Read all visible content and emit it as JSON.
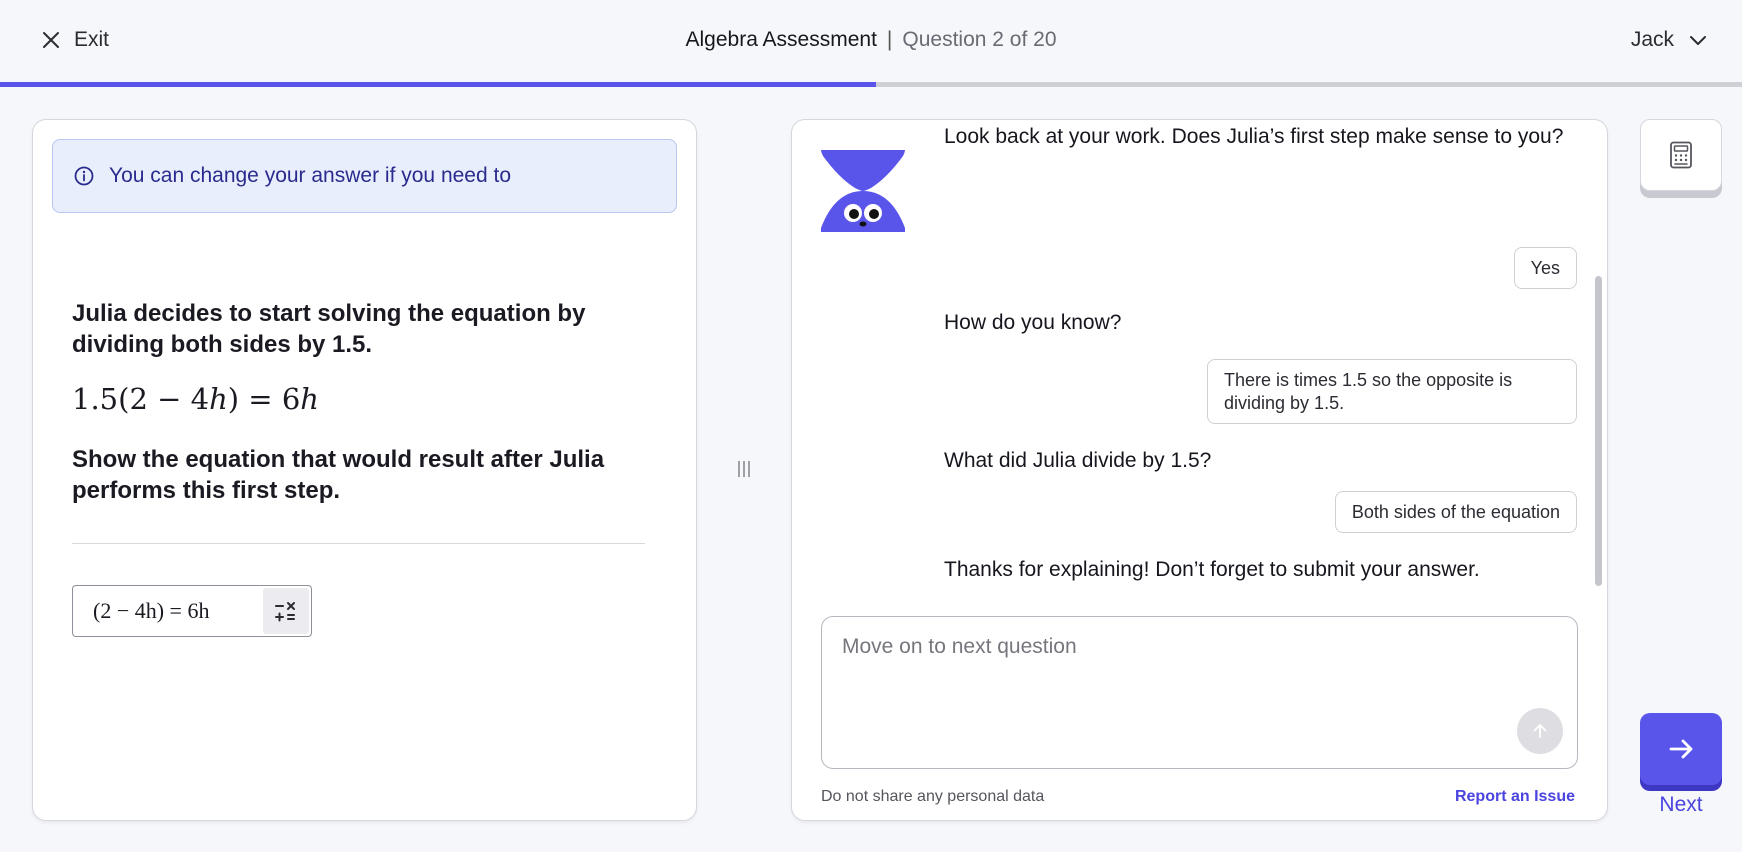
{
  "header": {
    "exit_label": "Exit",
    "assessment_title": "Algebra Assessment",
    "separator": "|",
    "question_counter": "Question 2 of 20",
    "user_name": "Jack",
    "progress_fraction": 0.503
  },
  "question_panel": {
    "info_banner": "You can change your answer if you need to",
    "prompt_intro": "Julia decides to start solving the equation by dividing both sides by 1.5.",
    "equation": {
      "lhs_number": "1.5",
      "lhs_open": "(2 − 4",
      "variable": "h",
      "lhs_close": ") = 6",
      "rhs_variable": "h"
    },
    "prompt_task": "Show the equation that would result after Julia performs this first step.",
    "answer_value": "(2 − 4h) = 6h"
  },
  "chat": {
    "messages": [
      {
        "role": "bot",
        "text": "Look back at your work. Does Julia’s first step make sense to you?"
      },
      {
        "role": "user",
        "text": "Yes"
      },
      {
        "role": "bot",
        "text": "How do you know?"
      },
      {
        "role": "user",
        "text": "There is times 1.5 so the opposite is dividing by 1.5."
      },
      {
        "role": "bot",
        "text": "What did Julia divide by 1.5?"
      },
      {
        "role": "user",
        "text": "Both sides of the equation"
      },
      {
        "role": "bot",
        "text": "Thanks for explaining! Don’t forget to submit your answer."
      }
    ],
    "input_placeholder": "Move on to next question",
    "disclaimer": "Do not share any personal data",
    "report_link": "Report an Issue"
  },
  "next_label": "Next",
  "icons": {
    "exit": "close-icon",
    "user_menu": "chevron-down-icon",
    "info": "info-icon",
    "math_keyboard": "math-operators-icon",
    "drag": "drag-handle-icon",
    "send": "arrow-up-icon",
    "calculator": "calculator-icon",
    "next": "arrow-right-icon"
  },
  "colors": {
    "accent": "#5a55ea",
    "accent_dark": "#3d37c4",
    "link": "#4a44e0",
    "info_bg": "#e9eefc",
    "info_text": "#2a2b8e"
  }
}
